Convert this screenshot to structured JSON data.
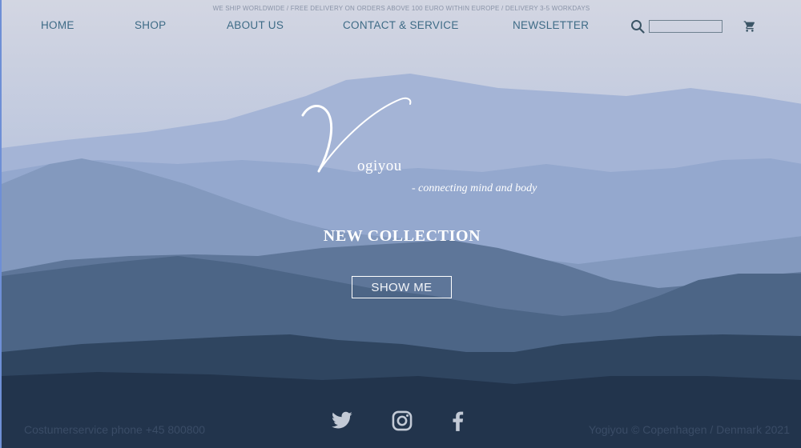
{
  "topline": "WE SHIP WORLDWIDE / FREE DELIVERY ON ORDERS ABOVE 100 EURO WITHIN EUROPE / DELIVERY 3-5 WORKDAYS",
  "nav": {
    "home": "HOME",
    "shop": "SHOP",
    "about": "ABOUT US",
    "contact": "CONTACT & SERVICE",
    "newsletter": "NEWSLETTER"
  },
  "search": {
    "value": "",
    "placeholder": ""
  },
  "icons": {
    "search": "search-icon",
    "cart": "cart-icon",
    "twitter": "twitter-icon",
    "instagram": "instagram-icon",
    "facebook": "facebook-icon"
  },
  "logo": {
    "initial": "Y",
    "rest": "ogiyou",
    "tagline": "- connecting mind and body"
  },
  "hero": {
    "heading": "NEW COLLECTION",
    "button": "SHOW ME"
  },
  "footer": {
    "phone": "Costumerservice phone +45 800800",
    "copyright": "Yogiyou © Copenhagen / Denmark 2021"
  },
  "colors": {
    "nav": "#3e6b86",
    "sky": "#c9d1e2",
    "mountain_far": "#8ea2c6",
    "mountain_near": "#22344c",
    "border_accent": "#6e8fd6"
  }
}
